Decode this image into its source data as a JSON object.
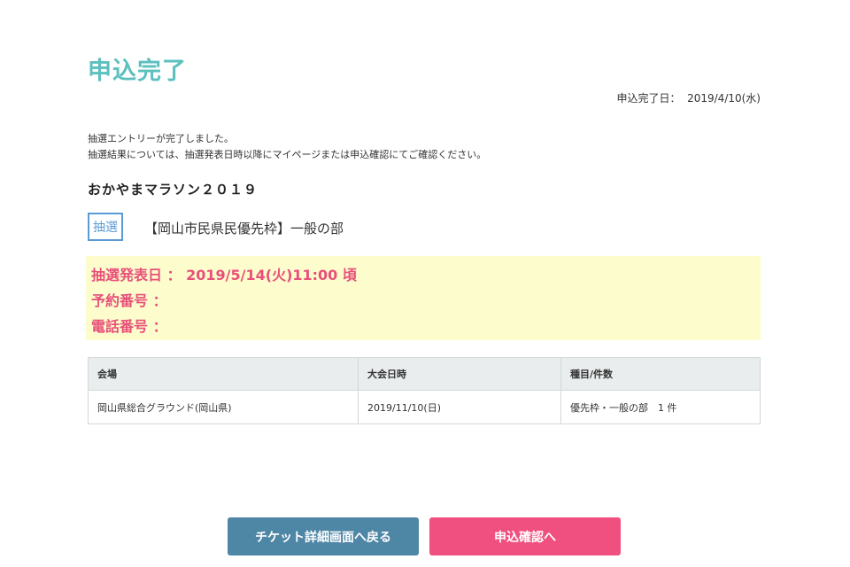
{
  "page": {
    "title": "申込完了",
    "complete_date": "申込完了日：  2019/4/10(水)"
  },
  "messages": {
    "line1": "抽選エントリーが完了しました。",
    "line2": "抽選結果については、抽選発表日時以降にマイページまたは申込確認にてご確認ください。"
  },
  "event": {
    "title": "おかやまマラソン２０１９",
    "badge": "抽選",
    "category": "【岡山市民県民優先枠】一般の部"
  },
  "info": {
    "announce": "抽選発表日 ： 2019/5/14(火)11:00 頃",
    "reservation": "予約番号 ：",
    "phone": "電話番号 ："
  },
  "table": {
    "headers": [
      "会場",
      "大会日時",
      "種目/件数"
    ],
    "rows": [
      [
        "岡山県総合グラウンド(岡山県)",
        "2019/11/10(日)",
        "優先枠・一般の部　1 件"
      ]
    ]
  },
  "buttons": {
    "back": "チケット詳細画面へ戻る",
    "confirm": "申込確認へ"
  },
  "colors": {
    "title": "#5bc0be",
    "highlight_text": "#e8507a",
    "highlight_bg": "#fcfccc",
    "back_button": "#4e86a5",
    "confirm_button": "#f0507f",
    "badge": "#5b9bd5"
  }
}
